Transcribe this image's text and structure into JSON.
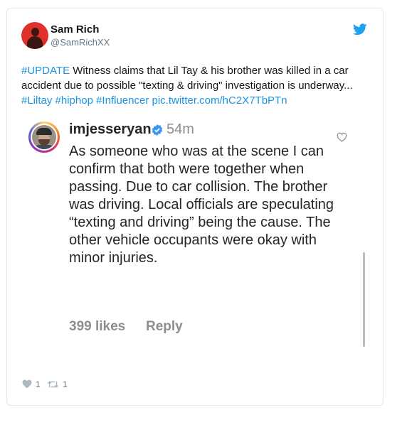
{
  "tweet": {
    "author_name": "Sam Rich",
    "author_handle": "@SamRichXX",
    "text_parts": {
      "hashtag_update": "#UPDATE",
      "body": " Witness claims that Lil Tay & his brother was killed in a car accident due to possible \"texting & driving\" investigation is underway... ",
      "hashtag_liltay": "#Liltay",
      "hashtag_hiphop": "#hiphop",
      "hashtag_influencer": "#Influencer",
      "pic_link": "pic.twitter.com/hC2X7TbPTn"
    },
    "like_count": "1",
    "retweet_count": "1",
    "link_color": "#1b95e0",
    "icons": [
      "twitter-bird-icon",
      "heart-icon",
      "retweet-icon"
    ]
  },
  "embedded_comment": {
    "username": "imjesseryan",
    "time": "54m",
    "text": "As someone who was at the scene I can confirm that both were together when passing. Due to car collision. The brother was driving. Local officials are speculating “texting and driving” being the cause. The other vehicle occupants were okay with minor injuries.",
    "likes": "399 likes",
    "reply_label": "Reply",
    "icons": [
      "verified-icon",
      "heart-outline-icon"
    ]
  }
}
